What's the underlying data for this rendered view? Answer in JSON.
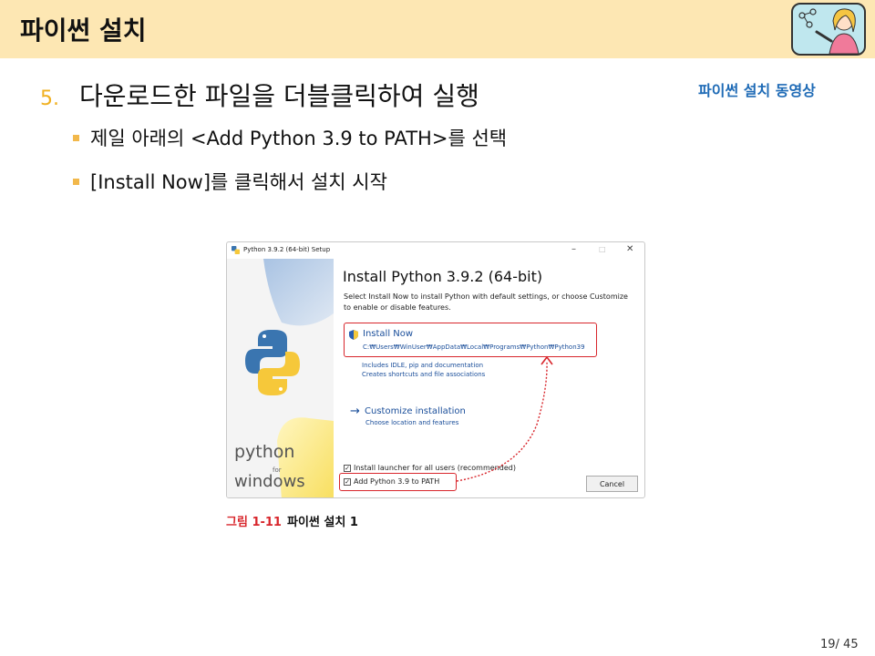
{
  "header": {
    "title": "파이썬 설치",
    "avatar_icon": "teacher-avatar-icon"
  },
  "video_link": "파이썬 설치 동영상",
  "step": {
    "number": "5.",
    "text": "다운로드한 파일을 더블클릭하여 실행"
  },
  "bullets": [
    "제일 아래의 <Add Python 3.9 to PATH>를 선택",
    "[Install Now]를 클릭해서 설치 시작"
  ],
  "installer": {
    "window_title": "Python 3.9.2 (64-bit) Setup",
    "minimize": "–",
    "maximize": "□",
    "close": "✕",
    "heading": "Install Python 3.9.2 (64-bit)",
    "description": "Select Install Now to install Python with default settings, or choose Customize to enable or disable features.",
    "install_now_label": "Install Now",
    "install_now_path": "C:₩Users₩WinUser₩AppData₩Local₩Programs₩Python₩Python39",
    "includes_line1": "Includes IDLE, pip and documentation",
    "includes_line2": "Creates shortcuts and file associations",
    "customize_label": "Customize installation",
    "customize_sub": "Choose location and features",
    "launcher_checkbox": "Install launcher for all users (recommended)",
    "path_checkbox": "Add Python 3.9 to PATH",
    "launcher_checked": true,
    "path_checked": true,
    "cancel_label": "Cancel",
    "brand_python": "python",
    "brand_for": "for",
    "brand_windows": "windows"
  },
  "caption": {
    "figure": "그림 1-11",
    "title": "파이썬 설치 1"
  },
  "page_number": "19/ 45",
  "colors": {
    "header_bg": "#fde7b3",
    "accent_red": "#d8262c",
    "link_blue": "#1f6bb6",
    "bullet_orange": "#f2b84b"
  }
}
